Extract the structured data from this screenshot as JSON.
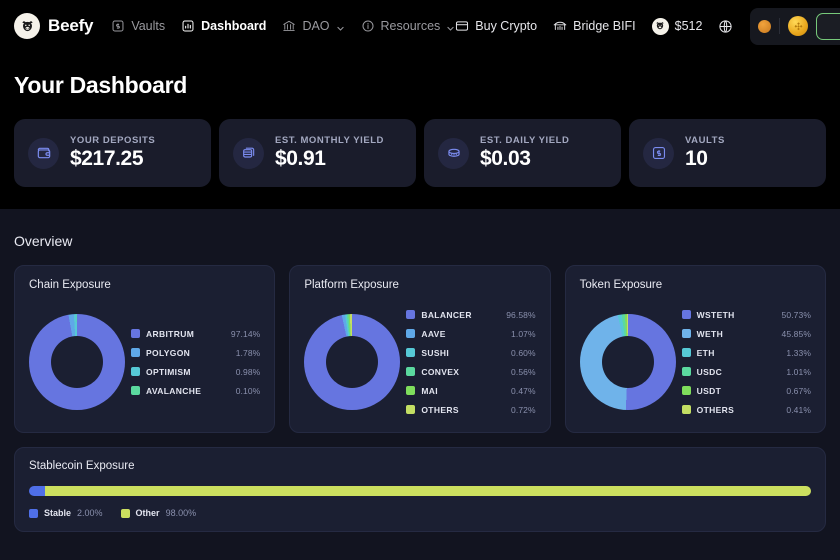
{
  "header": {
    "brand_name": "Beefy",
    "brand_logo_icon": "beefy-cow-logo",
    "nav": [
      {
        "label": "Vaults",
        "icon": "vaults-icon",
        "active": false,
        "caret": false
      },
      {
        "label": "Dashboard",
        "icon": "dashboard-chart-icon",
        "active": true,
        "caret": false
      },
      {
        "label": "DAO",
        "icon": "dao-bank-icon",
        "active": false,
        "caret": true
      },
      {
        "label": "Resources",
        "icon": "info-circle-icon",
        "active": false,
        "caret": true
      }
    ],
    "buy_crypto": "Buy Crypto",
    "buy_crypto_icon": "credit-card-icon",
    "bridge": "Bridge BIFI",
    "bridge_icon": "bridge-icon",
    "bifi_price": "$512",
    "bifi_icon": "beefy-coin-icon",
    "language_icon": "globe-icon",
    "chain_dot_icon": "chain-dot-icon",
    "chain_coin_icon": "bnb-coin-icon",
    "connect_label": "",
    "connect_border_color": "#77c97a"
  },
  "dashboard": {
    "title": "Your Dashboard",
    "stats": [
      {
        "label": "YOUR DEPOSITS",
        "value": "$217.25",
        "icon": "wallet-icon"
      },
      {
        "label": "EST. MONTHLY YIELD",
        "value": "$0.91",
        "icon": "coins-stack-icon"
      },
      {
        "label": "EST. DAILY YIELD",
        "value": "$0.03",
        "icon": "coin-icon"
      },
      {
        "label": "VAULTS",
        "value": "10",
        "icon": "vault-box-icon"
      }
    ]
  },
  "overview": {
    "title": "Overview"
  },
  "chart_data": [
    {
      "type": "pie",
      "title": "Chain Exposure",
      "legend": "right",
      "categories": [
        "ARBITRUM",
        "POLYGON",
        "OPTIMISM",
        "AVALANCHE"
      ],
      "values": [
        97.14,
        1.78,
        0.98,
        0.1
      ],
      "labels": [
        "97.14%",
        "1.78%",
        "0.98%",
        "0.10%"
      ],
      "colors": [
        "#6675e0",
        "#5fa8e8",
        "#56c9d6",
        "#5bd99f"
      ]
    },
    {
      "type": "pie",
      "title": "Platform Exposure",
      "legend": "right",
      "categories": [
        "BALANCER",
        "AAVE",
        "SUSHI",
        "CONVEX",
        "MAI",
        "OTHERS"
      ],
      "values": [
        96.58,
        1.07,
        0.6,
        0.56,
        0.47,
        0.72
      ],
      "labels": [
        "96.58%",
        "1.07%",
        "0.60%",
        "0.56%",
        "0.47%",
        "0.72%"
      ],
      "colors": [
        "#6675e0",
        "#5fa8e8",
        "#56c9d6",
        "#5bd99f",
        "#7fdd5c",
        "#c3de63"
      ]
    },
    {
      "type": "pie",
      "title": "Token Exposure",
      "legend": "right",
      "categories": [
        "WSTETH",
        "WETH",
        "ETH",
        "USDC",
        "USDT",
        "OTHERS"
      ],
      "values": [
        50.73,
        45.85,
        1.33,
        1.01,
        0.67,
        0.41
      ],
      "labels": [
        "50.73%",
        "45.85%",
        "1.33%",
        "1.01%",
        "0.67%",
        "0.41%"
      ],
      "colors": [
        "#6675e0",
        "#6fb3ea",
        "#56c9d6",
        "#5bd99f",
        "#7fdd5c",
        "#c3de63"
      ]
    },
    {
      "type": "bar",
      "title": "Stablecoin Exposure",
      "orientation": "horizontal-stacked",
      "categories": [
        "Stable",
        "Other"
      ],
      "values": [
        2.0,
        98.0
      ],
      "labels": [
        "2.00%",
        "98.00%"
      ],
      "colors": [
        "#4f6fe8",
        "#ccdf5f"
      ]
    }
  ]
}
